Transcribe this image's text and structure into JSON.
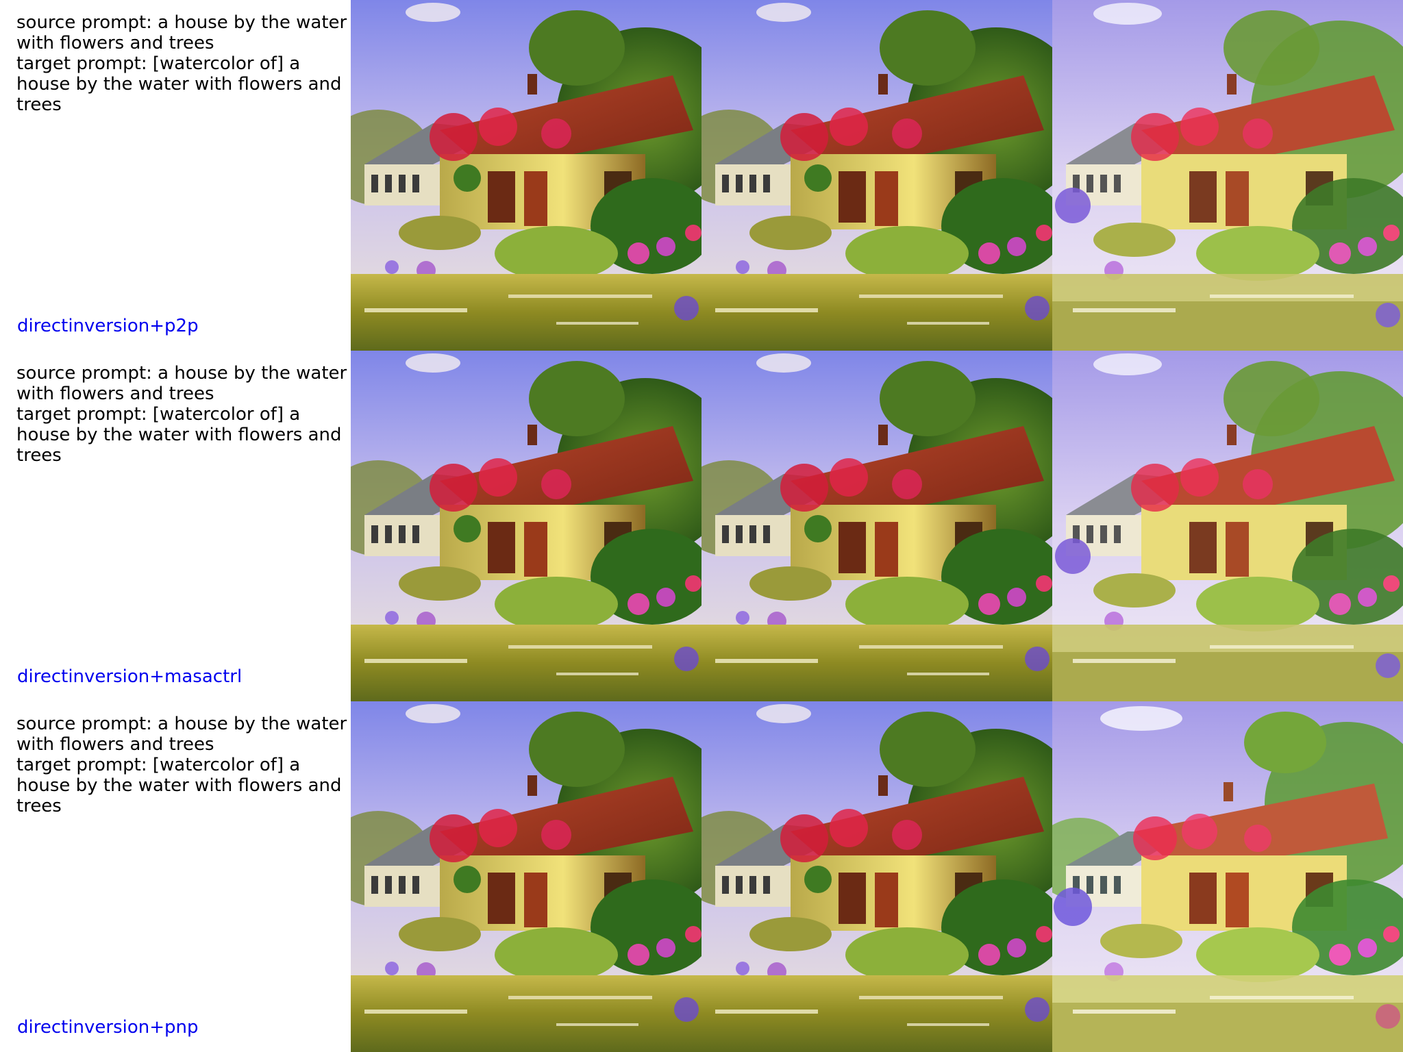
{
  "rows": [
    {
      "source_prompt": "source prompt: a house by the water with flowers and trees",
      "target_prompt": "target prompt: [watercolor of] a house by the water with flowers and trees",
      "method": "directinversion+p2p",
      "images": [
        "house-by-water-painting",
        "house-by-water-painting",
        "house-by-water-watercolor"
      ]
    },
    {
      "source_prompt": "source prompt: a house by the water with flowers and trees",
      "target_prompt": "target prompt: [watercolor of] a house by the water with flowers and trees",
      "method": "directinversion+masactrl",
      "images": [
        "house-by-water-painting",
        "house-by-water-painting",
        "house-by-water-watercolor"
      ]
    },
    {
      "source_prompt": "source prompt: a house by the water with flowers and trees",
      "target_prompt": "target prompt: [watercolor of] a house by the water with flowers and trees",
      "method": "directinversion+pnp",
      "images": [
        "house-by-water-painting",
        "house-by-water-painting",
        "house-by-water-watercolor"
      ]
    }
  ],
  "colors": {
    "prompt_text": "#000000",
    "method_label": "#0000ee",
    "background": "#ffffff"
  }
}
